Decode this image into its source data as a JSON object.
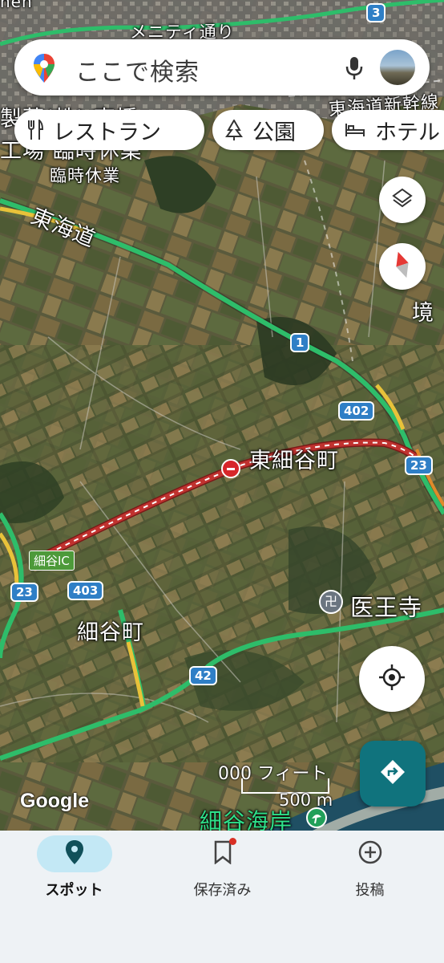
{
  "search": {
    "placeholder": "ここで検索",
    "maps-pin-icon": "google-maps-pin",
    "mic-icon": "microphone"
  },
  "chips": [
    {
      "label": "レストラン",
      "icon": "fork-knife-icon"
    },
    {
      "label": "公園",
      "icon": "tree-icon"
    },
    {
      "label": "ホテル",
      "icon": "bed-icon"
    }
  ],
  "map": {
    "labels": {
      "top_road_partial": "メニティ通り",
      "factory_partial": "製薬(株) 東播",
      "factory_line2": "工場 臨時休業",
      "temp_closed": "臨時休業",
      "tokaido": "東海道",
      "tokaido_shinkansen": "東海道新幹線",
      "border": "境",
      "higashi_hosoya": "東細谷町",
      "hosoya_ic": "細谷IC",
      "hosoya_town": "細谷町",
      "iouji": "医王寺",
      "hosoya_beach": "細谷海岸",
      "top_left_partial": "hen"
    },
    "shields": {
      "r1": "1",
      "r402": "402",
      "r23_right": "23",
      "r23_left": "23",
      "r403": "403",
      "r42": "42",
      "r3": "3"
    },
    "scale": {
      "feet": "000 フィート",
      "meters": "500 m"
    },
    "logo": "Google",
    "colors": {
      "highway": "#2ebd6a",
      "closure": "#c0322f",
      "shield": "#2f7fc6"
    }
  },
  "bottom_nav": {
    "items": [
      {
        "label": "スポット",
        "icon": "location-pin-icon",
        "active": true
      },
      {
        "label": "保存済み",
        "icon": "bookmark-icon",
        "active": false,
        "badge": true
      },
      {
        "label": "投稿",
        "icon": "add-circle-icon",
        "active": false
      }
    ]
  }
}
